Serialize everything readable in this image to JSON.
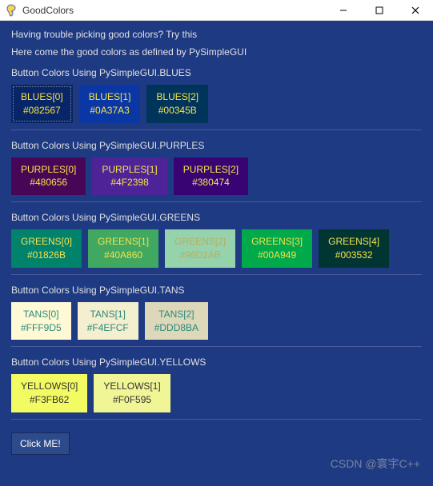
{
  "window": {
    "title": "GoodColors"
  },
  "intro": {
    "line1": "Having trouble picking good colors? Try this",
    "line2": "Here come the good colors as defined by PySimpleGUI"
  },
  "sections": {
    "blues": {
      "label": "Button Colors Using PySimpleGUI.BLUES",
      "items": [
        {
          "name": "BLUES[0]",
          "hex": "#082567",
          "fg": "#f5e24a"
        },
        {
          "name": "BLUES[1]",
          "hex": "#0A37A3",
          "fg": "#f5e24a"
        },
        {
          "name": "BLUES[2]",
          "hex": "#00345B",
          "fg": "#f5e24a"
        }
      ]
    },
    "purples": {
      "label": "Button Colors Using PySimpleGUI.PURPLES",
      "items": [
        {
          "name": "PURPLES[0]",
          "hex": "#480656",
          "fg": "#f5e24a"
        },
        {
          "name": "PURPLES[1]",
          "hex": "#4F2398",
          "fg": "#f5e24a"
        },
        {
          "name": "PURPLES[2]",
          "hex": "#380474",
          "fg": "#f5e24a"
        }
      ]
    },
    "greens": {
      "label": "Button Colors Using PySimpleGUI.GREENS",
      "items": [
        {
          "name": "GREENS[0]",
          "hex": "#01826B",
          "fg": "#f5e24a"
        },
        {
          "name": "GREENS[1]",
          "hex": "#40A860",
          "fg": "#f5e24a"
        },
        {
          "name": "GREENS[2]",
          "hex": "#96D2AB",
          "fg": "#b8b060"
        },
        {
          "name": "GREENS[3]",
          "hex": "#00A949",
          "fg": "#f5e24a"
        },
        {
          "name": "GREENS[4]",
          "hex": "#003532",
          "fg": "#f5e24a"
        }
      ]
    },
    "tans": {
      "label": "Button Colors Using PySimpleGUI.TANS",
      "items": [
        {
          "name": "TANS[0]",
          "hex": "#FFF9D5",
          "fg": "#2a8a7a"
        },
        {
          "name": "TANS[1]",
          "hex": "#F4EFCF",
          "fg": "#2a8a7a"
        },
        {
          "name": "TANS[2]",
          "hex": "#DDD8BA",
          "fg": "#2a8a7a"
        }
      ]
    },
    "yellows": {
      "label": "Button Colors Using PySimpleGUI.YELLOWS",
      "items": [
        {
          "name": "YELLOWS[0]",
          "hex": "#F3FB62",
          "fg": "#333"
        },
        {
          "name": "YELLOWS[1]",
          "hex": "#F0F595",
          "fg": "#333"
        }
      ]
    }
  },
  "click_me": "Click ME!",
  "watermark": "CSDN @寰宇C++"
}
